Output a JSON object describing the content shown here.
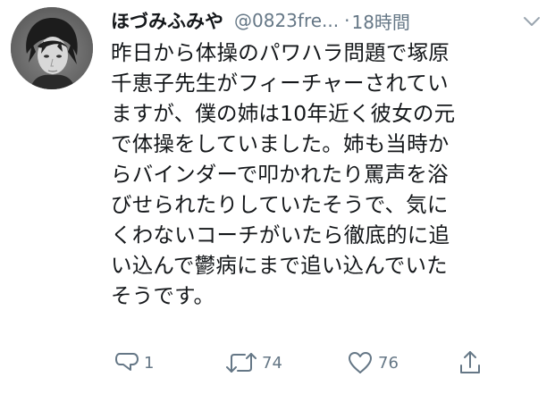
{
  "tweet": {
    "display_name": "ほづみふみや",
    "handle": "@0823fre...",
    "separator": "·",
    "time": "18時間",
    "lines": [
      "昨日から体操のパワハラ問題で塚原",
      "千恵子先生がフィーチャーされてい",
      "ますが、僕の姉は10年近く彼女の元",
      "で体操をしていました。姉も当時か",
      "らバインダーで叩かれたり罵声を浴",
      "びせられたりしていたそうで、気に",
      "くわないコーチがいたら徹底的に追",
      "い込んで鬱病にまで追い込んでいた",
      "そうです。"
    ]
  },
  "actions": {
    "reply_count": "1",
    "retweet_count": "74",
    "like_count": "76"
  },
  "icons": {
    "avatar": "profile-photo",
    "caret": "chevron-down-icon",
    "reply": "reply-icon",
    "retweet": "retweet-icon",
    "like": "heart-icon",
    "share": "share-icon"
  },
  "colors": {
    "text": "#14171a",
    "secondary": "#657786"
  }
}
